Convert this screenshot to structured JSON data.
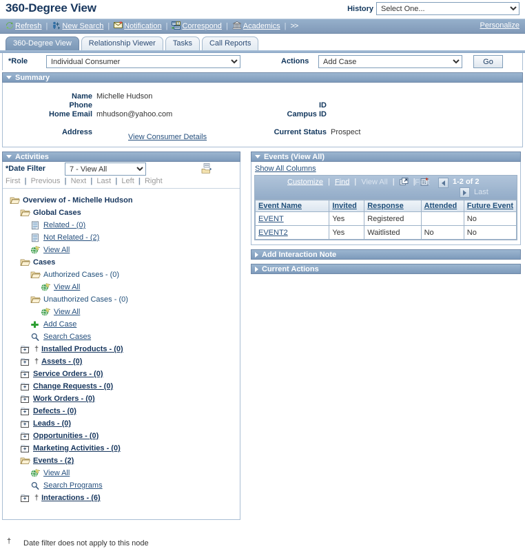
{
  "header": {
    "title": "360-Degree View",
    "history_label": "History",
    "history_value": "Select One..."
  },
  "toolbar": {
    "items": [
      {
        "label": "Refresh",
        "icon": "refresh-icon"
      },
      {
        "label": "New Search",
        "icon": "new-search-icon"
      },
      {
        "label": "Notification",
        "icon": "notification-icon"
      },
      {
        "label": "Correspond",
        "icon": "correspond-icon"
      },
      {
        "label": "Academics",
        "icon": "academics-icon"
      }
    ],
    "more": ">>",
    "personalize": "Personalize",
    "separator": "|"
  },
  "tabs": [
    {
      "label": "360-Degree View",
      "active": true
    },
    {
      "label": "Relationship Viewer",
      "active": false
    },
    {
      "label": "Tasks",
      "active": false
    },
    {
      "label": "Call Reports",
      "active": false
    }
  ],
  "rolerow": {
    "role_label": "*Role",
    "role_value": "Individual Consumer",
    "actions_label": "Actions",
    "actions_value": "Add Case",
    "go_label": "Go"
  },
  "summary": {
    "title": "Summary",
    "name_label": "Name",
    "name_value": "Michelle Hudson",
    "phone_label": "Phone",
    "phone_value": "",
    "email_label": "Home Email",
    "email_value": "mhudson@yahoo.com",
    "address_label": "Address",
    "address_value": "",
    "id_label": "ID",
    "id_value": "",
    "campus_id_label": "Campus ID",
    "campus_id_value": "",
    "status_label": "Current Status",
    "status_value": "Prospect",
    "view_details": "View Consumer Details"
  },
  "activities": {
    "title": "Activities",
    "date_filter_label": "*Date Filter",
    "date_filter_value": "7 - View All",
    "tree_icon": "tree-expand-icon",
    "nav": [
      "First",
      "Previous",
      "Next",
      "Last",
      "Left",
      "Right"
    ],
    "tree": [
      {
        "indent": 0,
        "icon": "folder-open-icon",
        "text": "Overview of - Michelle Hudson",
        "bold": true,
        "link": false,
        "dagger": false
      },
      {
        "indent": 1,
        "icon": "folder-open-icon",
        "text": "Global Cases",
        "bold": true,
        "link": false,
        "dagger": false
      },
      {
        "indent": 2,
        "icon": "document-icon",
        "text": "Related - (0)",
        "bold": false,
        "link": true,
        "dagger": false
      },
      {
        "indent": 2,
        "icon": "document-icon",
        "text": "Not Related - (2)",
        "bold": false,
        "link": true,
        "dagger": false
      },
      {
        "indent": 2,
        "icon": "globe-icon",
        "text": "View All",
        "bold": false,
        "link": true,
        "dagger": false
      },
      {
        "indent": 1,
        "icon": "folder-open-icon",
        "text": "Cases",
        "bold": true,
        "link": false,
        "dagger": false
      },
      {
        "indent": 2,
        "icon": "folder-open-icon",
        "text": "Authorized Cases - (0)",
        "bold": false,
        "link": false,
        "dagger": false
      },
      {
        "indent": 3,
        "icon": "globe-icon",
        "text": "View All",
        "bold": false,
        "link": true,
        "dagger": false
      },
      {
        "indent": 2,
        "icon": "folder-open-icon",
        "text": "Unauthorized Cases - (0)",
        "bold": false,
        "link": false,
        "dagger": false
      },
      {
        "indent": 3,
        "icon": "globe-icon",
        "text": "View All",
        "bold": false,
        "link": true,
        "dagger": false
      },
      {
        "indent": 2,
        "icon": "plus-add-icon",
        "text": "Add Case",
        "bold": false,
        "link": true,
        "dagger": false
      },
      {
        "indent": 2,
        "icon": "magnifier-icon",
        "text": "Search Cases",
        "bold": false,
        "link": true,
        "dagger": false
      },
      {
        "indent": 1,
        "icon": "folder-closed-icon",
        "text": "Installed Products - (0)",
        "bold": true,
        "link": true,
        "dagger": true
      },
      {
        "indent": 1,
        "icon": "folder-closed-icon",
        "text": "Assets - (0)",
        "bold": true,
        "link": true,
        "dagger": true
      },
      {
        "indent": 1,
        "icon": "folder-closed-icon",
        "text": "Service Orders - (0)",
        "bold": true,
        "link": true,
        "dagger": false
      },
      {
        "indent": 1,
        "icon": "folder-closed-icon",
        "text": "Change Requests - (0)",
        "bold": true,
        "link": true,
        "dagger": false
      },
      {
        "indent": 1,
        "icon": "folder-closed-icon",
        "text": "Work Orders - (0)",
        "bold": true,
        "link": true,
        "dagger": false
      },
      {
        "indent": 1,
        "icon": "folder-closed-icon",
        "text": "Defects - (0)",
        "bold": true,
        "link": true,
        "dagger": false
      },
      {
        "indent": 1,
        "icon": "folder-closed-icon",
        "text": "Leads - (0)",
        "bold": true,
        "link": true,
        "dagger": false
      },
      {
        "indent": 1,
        "icon": "folder-closed-icon",
        "text": "Opportunities - (0)",
        "bold": true,
        "link": true,
        "dagger": false
      },
      {
        "indent": 1,
        "icon": "folder-closed-icon",
        "text": "Marketing Activities - (0)",
        "bold": true,
        "link": true,
        "dagger": false
      },
      {
        "indent": 1,
        "icon": "folder-open-icon",
        "text": "Events - (2)",
        "bold": true,
        "link": true,
        "dagger": false
      },
      {
        "indent": 2,
        "icon": "globe-icon",
        "text": "View All",
        "bold": false,
        "link": true,
        "dagger": false
      },
      {
        "indent": 2,
        "icon": "magnifier-icon",
        "text": "Search Programs",
        "bold": false,
        "link": true,
        "dagger": false
      },
      {
        "indent": 1,
        "icon": "folder-closed-icon",
        "text": "Interactions - (6)",
        "bold": true,
        "link": true,
        "dagger": true
      }
    ]
  },
  "events": {
    "title": "Events (View All)",
    "show_all_columns": "Show All Columns",
    "grid_nav": {
      "customize": "Customize",
      "find": "Find",
      "view_all": "View All",
      "download_icon": "download-icon",
      "grid_icon": "grid-icon",
      "first": "First",
      "count": "1-2 of 2",
      "last": "Last",
      "separator": "|"
    },
    "columns": [
      "Event Name",
      "Invited",
      "Response",
      "Attended",
      "Future Event"
    ],
    "rows": [
      {
        "event_name": "EVENT",
        "invited": "Yes",
        "response": "Registered",
        "attended": "",
        "future_event": "No"
      },
      {
        "event_name": "EVENT2",
        "invited": "Yes",
        "response": "Waitlisted",
        "attended": "No",
        "future_event": "No"
      }
    ]
  },
  "add_interaction_note": {
    "title": "Add Interaction Note"
  },
  "current_actions": {
    "title": "Current Actions"
  },
  "footnote": {
    "symbol": "†",
    "text": "Date filter does not apply to this node"
  },
  "colors": {
    "title": "#17365d",
    "toolbar_bg": "#8ba7c6",
    "panel_header": "#7d9abb",
    "link": "#254f7d",
    "border": "#a9bdd3"
  }
}
